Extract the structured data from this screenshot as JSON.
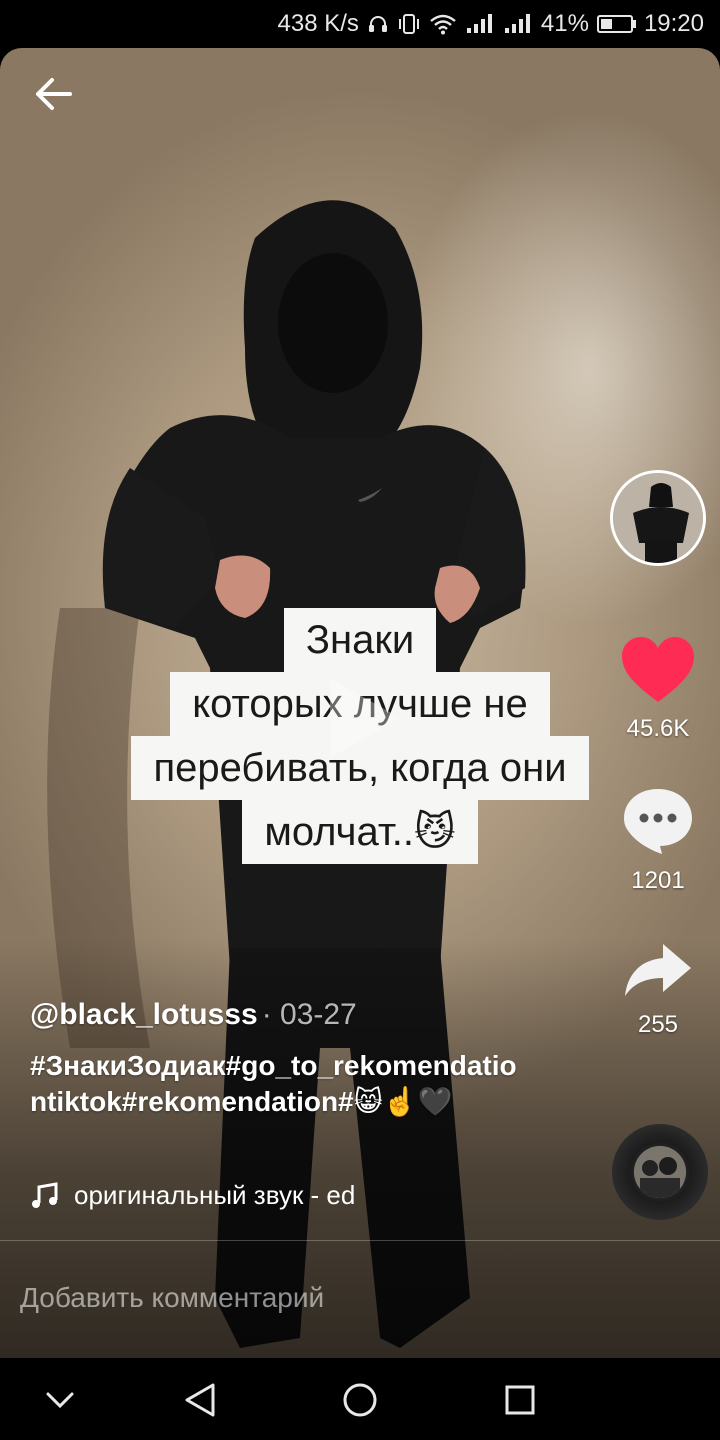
{
  "status_bar": {
    "speed": "438 K/s",
    "battery_percent": "41%",
    "battery_level": 0.41,
    "time": "19:20"
  },
  "video": {
    "overlay_lines": [
      "Знаки",
      "которых лучше не",
      "перебивать, когда они",
      "молчат..😼"
    ]
  },
  "actions": {
    "likes": "45.6K",
    "comments": "1201",
    "shares": "255",
    "like_color": "#fe2c55"
  },
  "post": {
    "author": "@black_lotusss",
    "date": "· 03-27",
    "hashtags": "#ЗнакиЗодиак#go_to_rekomendationtiktok#rekomendation#😸☝️🖤",
    "music": "оригинальный звук - ed"
  },
  "comment": {
    "placeholder": "Добавить комментарий"
  }
}
